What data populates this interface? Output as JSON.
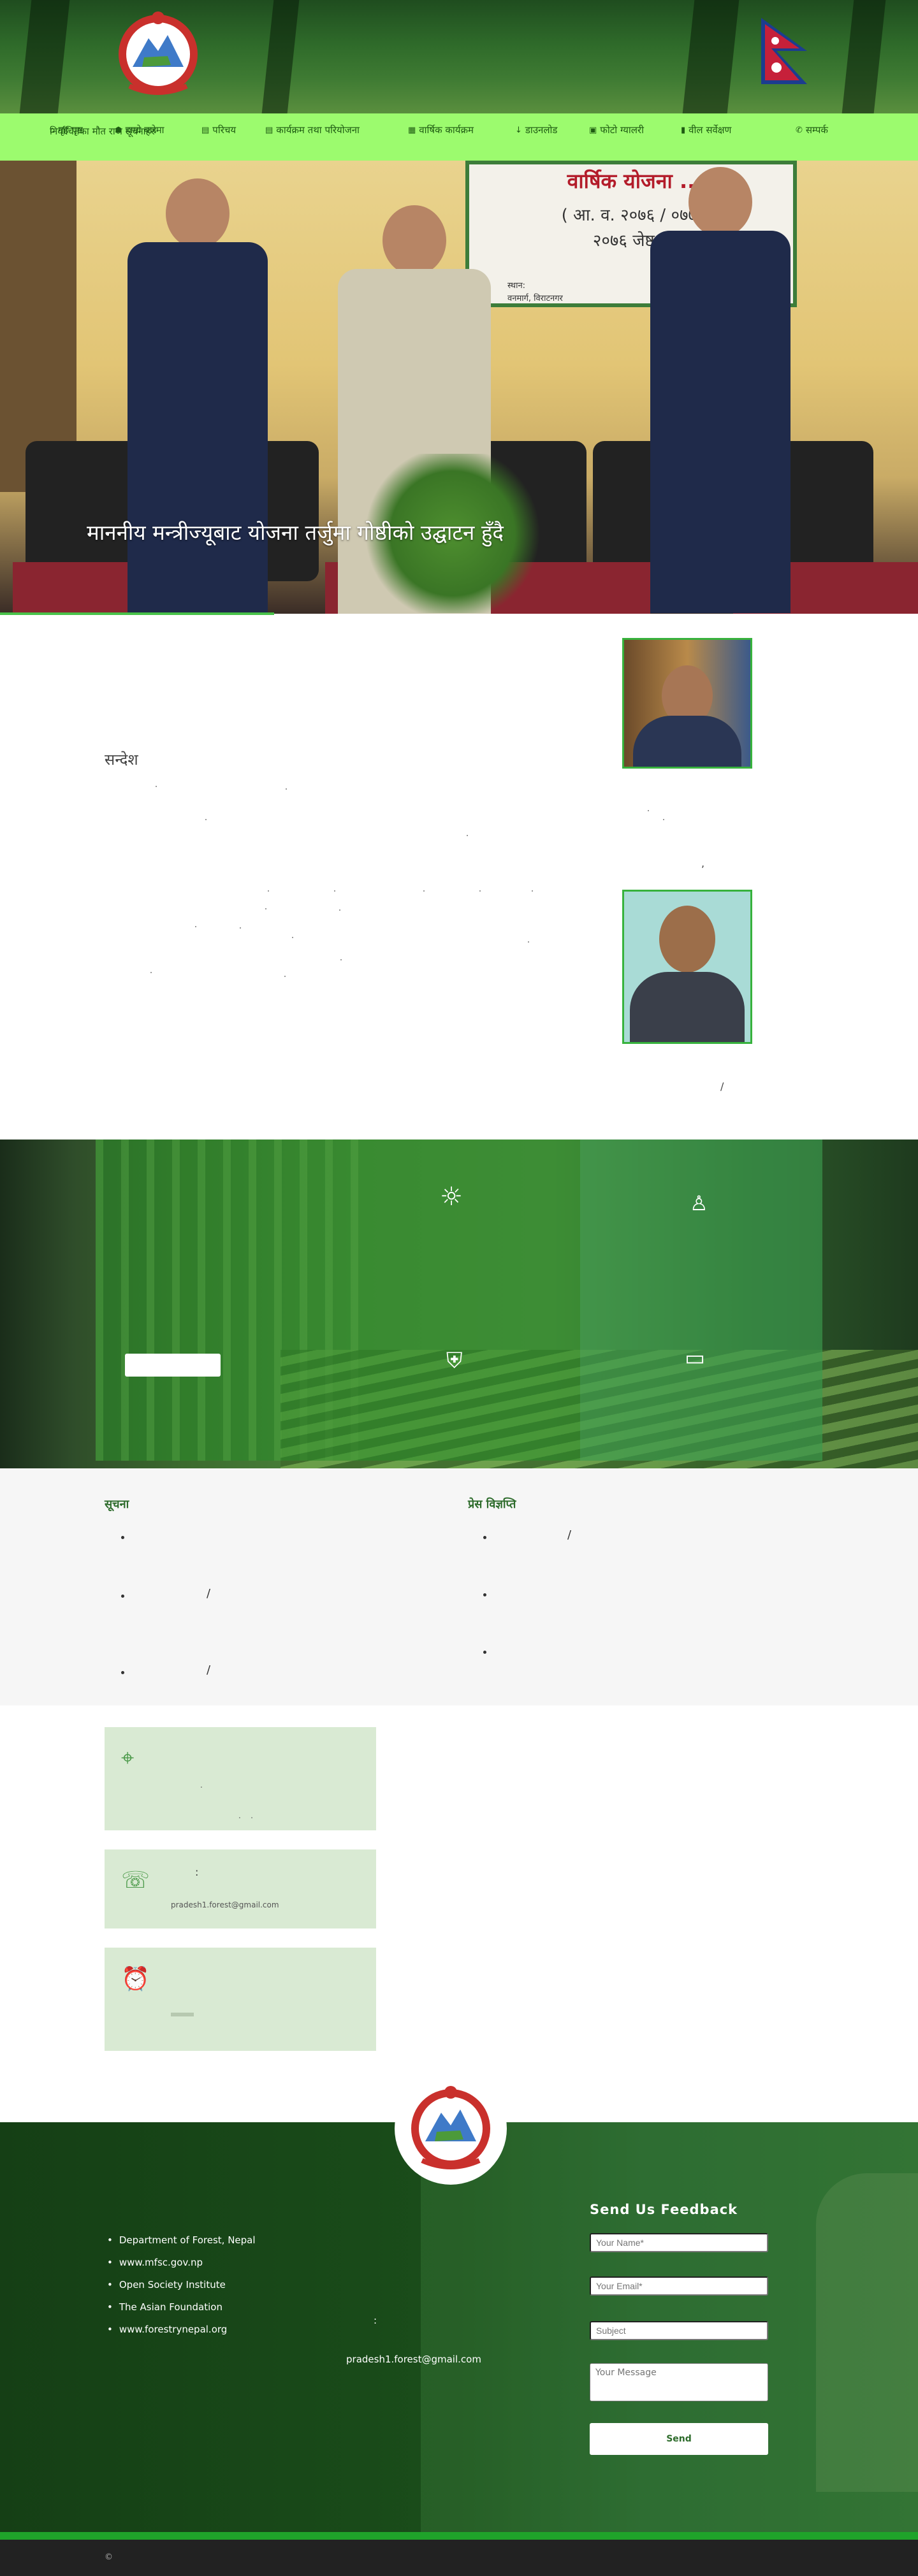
{
  "colors": {
    "nav_bg": "#9cfb6e",
    "accent_green": "#37b23d",
    "footer_bg": "#1a4d1a",
    "send_text": "#2d6b2b"
  },
  "header": {
    "emblem_icon": "nepal-government-emblem",
    "flag_icon": "nepal-flag",
    "subtitle": "निर्वाचितका मौत राज सूचनाहरु",
    "nav": [
      {
        "label": "गृह पृष्ठ",
        "icon": "home-icon"
      },
      {
        "label": "हाम्रो बारेमा",
        "icon": "users-icon"
      },
      {
        "label": "परिचय",
        "icon": "book-icon"
      },
      {
        "label": "कार्यक्रम तथा परियोजना",
        "icon": "document-icon"
      },
      {
        "label": "वार्षिक कार्यक्रम",
        "icon": "calendar-icon"
      },
      {
        "label": "डाउनलोड",
        "icon": "download-icon"
      },
      {
        "label": "फोटो ग्यालरी",
        "icon": "photo-icon"
      },
      {
        "label": "वील सर्वेक्षण",
        "icon": "info-icon"
      },
      {
        "label": "सम्पर्क",
        "icon": "phone-icon"
      }
    ]
  },
  "hero": {
    "caption": "माननीय मन्त्रीज्यूबाट योजना तर्जुमा गोष्ठीको उद्घाटन हुँदै",
    "banner_text": [
      "वार्षिक योजना ...",
      "( आ. व. २०७६ / ०७७ )",
      "२०७६ जेष्ठ १८",
      "स्थान:",
      "वनमार्ग, विराटनगर"
    ]
  },
  "message": {
    "title": "सन्देश",
    "comma": ",",
    "slash": "/"
  },
  "forest": {
    "button_label": "",
    "icons": [
      "hand-plant-icon",
      "farmer-icon",
      "shield-icon",
      "wallet-icon"
    ]
  },
  "news": {
    "col1_title": "सूचना",
    "col2_title": "प्रेस विज्ञप्ति"
  },
  "contact": {
    "map_icon": "map-icon",
    "phone_icon": "phone-icon",
    "clock_icon": "clock-icon",
    "colon": ":",
    "email": "pradesh1.forest@gmail.com"
  },
  "footer": {
    "links": [
      "Department of Forest, Nepal",
      "www.mfsc.gov.np",
      "Open Society Institute",
      "The Asian Foundation",
      "www.forestrynepal.org"
    ],
    "email": "pradesh1.forest@gmail.com",
    "colon": ":",
    "feedback": {
      "title": "Send Us Feedback",
      "name_ph": "Your Name*",
      "email_ph": "Your Email*",
      "subject_ph": "Subject",
      "message_ph": "Your Message",
      "send": "Send"
    },
    "copyright": "©"
  }
}
